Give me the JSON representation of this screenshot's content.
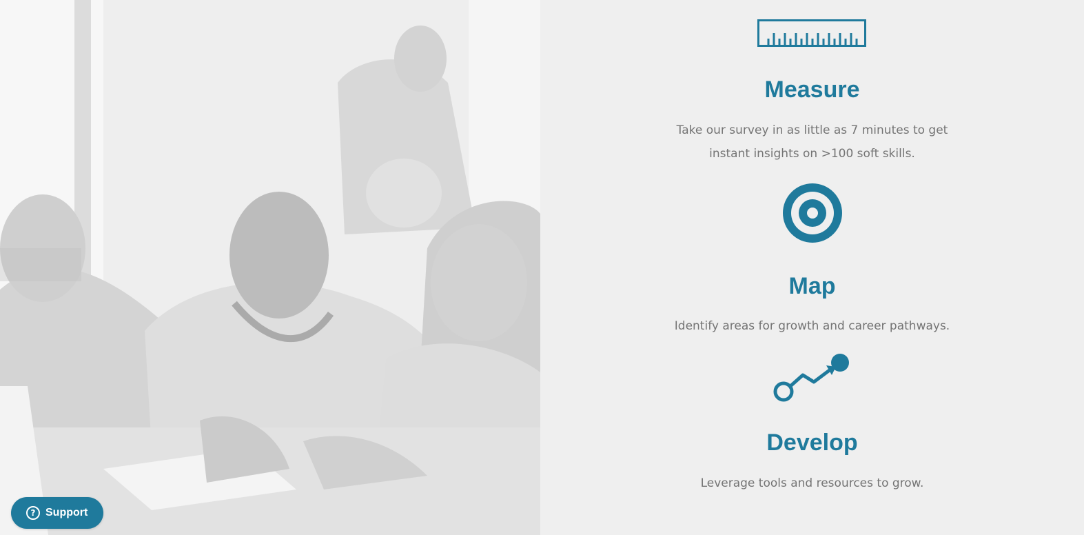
{
  "hero_image": {
    "alt": "Three colleagues smiling while reviewing documents at a table"
  },
  "colors": {
    "accent": "#1f7a9c",
    "body_text": "#747474",
    "panel_background": "#efefef"
  },
  "features": [
    {
      "icon": "ruler-icon",
      "title": "Measure",
      "text": "Take our survey in as little as 7 minutes to get instant insights on >100 soft skills."
    },
    {
      "icon": "target-icon",
      "title": "Map",
      "text": "Identify areas for growth and career pathways."
    },
    {
      "icon": "growth-path-icon",
      "title": "Develop",
      "text": "Leverage tools and resources to grow."
    }
  ],
  "support": {
    "label": "Support",
    "icon": "question-circle-icon"
  }
}
